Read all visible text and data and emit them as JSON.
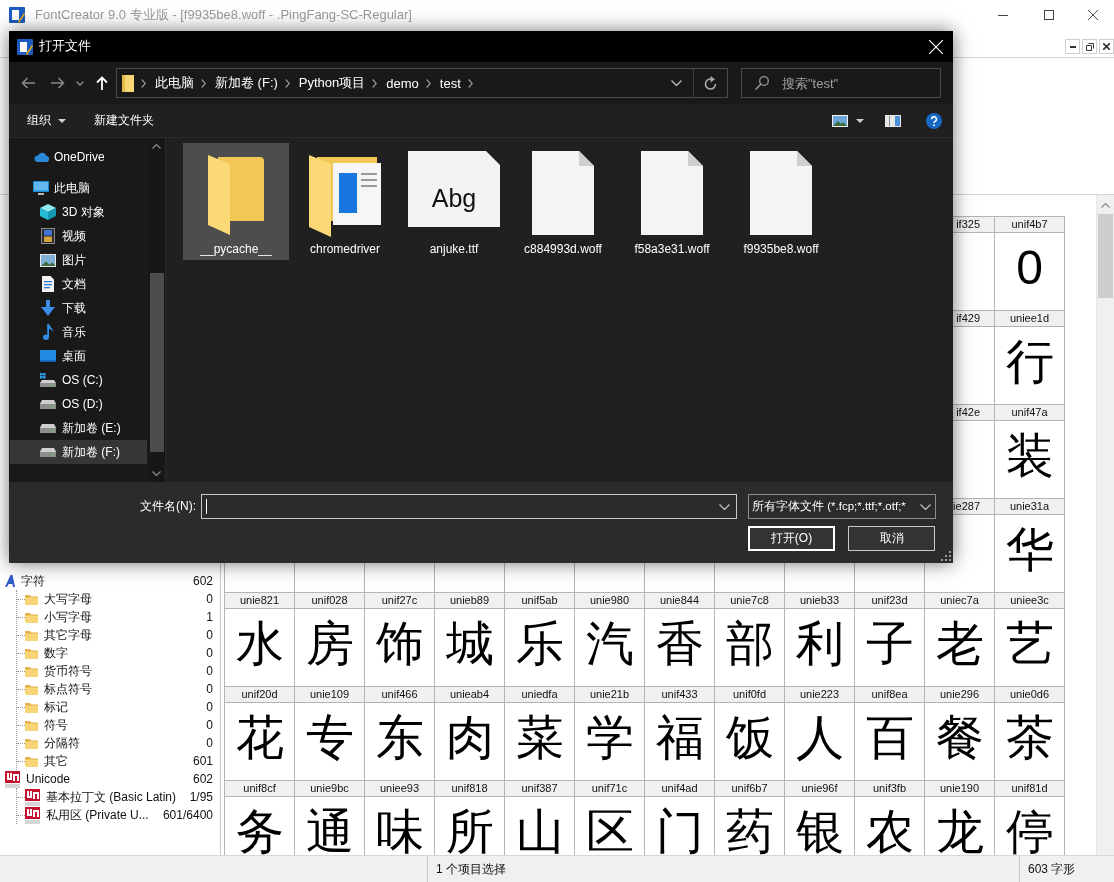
{
  "app_window": {
    "title": "FontCreator 9.0 专业版 - [f9935be8.woff - .PingFang-SC-Regular]"
  },
  "dialog": {
    "title": "打开文件",
    "address": {
      "path": [
        "此电脑",
        "新加卷 (F:)",
        "Python项目",
        "demo",
        "test"
      ]
    },
    "search": {
      "placeholder": "搜索\"test\""
    },
    "toolbar": {
      "organize": "组织",
      "new_folder": "新建文件夹"
    },
    "navigation": {
      "items": [
        {
          "label": "OneDrive",
          "kind": "cloud",
          "selected": false
        },
        {
          "label": "此电脑",
          "kind": "computer",
          "selected": false,
          "children": [
            {
              "label": "3D 对象",
              "kind": "objects3d",
              "selected": false
            },
            {
              "label": "视频",
              "kind": "videos",
              "selected": false
            },
            {
              "label": "图片",
              "kind": "pictures",
              "selected": false
            },
            {
              "label": "文档",
              "kind": "documents",
              "selected": false
            },
            {
              "label": "下载",
              "kind": "downloads",
              "selected": false
            },
            {
              "label": "音乐",
              "kind": "music",
              "selected": false
            },
            {
              "label": "桌面",
              "kind": "desktop",
              "selected": false
            },
            {
              "label": "OS (C:)",
              "kind": "system_drive",
              "selected": false
            },
            {
              "label": "OS (D:)",
              "kind": "drive",
              "selected": false
            },
            {
              "label": "新加卷 (E:)",
              "kind": "drive",
              "selected": false
            },
            {
              "label": "新加卷 (F:)",
              "kind": "drive",
              "selected": true
            }
          ]
        }
      ]
    },
    "files": [
      {
        "name": "__pycache__",
        "kind": "folder",
        "selected": true
      },
      {
        "name": "chromedriver",
        "kind": "app_folder",
        "selected": false
      },
      {
        "name": "anjuke.ttf",
        "kind": "font",
        "preview": "Abg",
        "selected": false
      },
      {
        "name": "c884993d.woff",
        "kind": "file",
        "selected": false
      },
      {
        "name": "f58a3e31.woff",
        "kind": "file",
        "selected": false
      },
      {
        "name": "f9935be8.woff",
        "kind": "file",
        "selected": false
      }
    ],
    "filename": {
      "label": "文件名(N):"
    },
    "file_type": {
      "value": "所有字体文件 (*.fcp;*.ttf;*.otf;*"
    },
    "buttons": [
      {
        "label": "打开(O)",
        "default": true
      },
      {
        "label": "取消",
        "default": false
      }
    ]
  },
  "sidebar": {
    "groups": [
      {
        "kind": "characters",
        "label": "字符",
        "count": "602",
        "children": [
          {
            "label": "大写字母",
            "count": "0"
          },
          {
            "label": "小写字母",
            "count": "1"
          },
          {
            "label": "其它字母",
            "count": "0"
          },
          {
            "label": "数字",
            "count": "0"
          },
          {
            "label": "货币符号",
            "count": "0"
          },
          {
            "label": "标点符号",
            "count": "0"
          },
          {
            "label": "标记",
            "count": "0"
          },
          {
            "label": "符号",
            "count": "0"
          },
          {
            "label": "分隔符",
            "count": "0"
          },
          {
            "label": "其它",
            "count": "601"
          }
        ]
      },
      {
        "kind": "unicode",
        "label": "Unicode",
        "count": "602",
        "children": [
          {
            "label": "基本拉丁文 (Basic Latin)",
            "count": "1/95"
          },
          {
            "label": "私用区 (Private U...",
            "count": "601/6400"
          }
        ]
      }
    ]
  },
  "glyph_grid": {
    "rows": [
      {
        "cells": [
          {
            "label": "if325"
          },
          {
            "label": "unif4b7",
            "glyph": "0"
          }
        ]
      },
      {
        "cells": [
          {
            "label": "if429"
          },
          {
            "label": "uniee1d",
            "glyph": "行"
          }
        ]
      },
      {
        "cells": [
          {
            "label": "if42e"
          },
          {
            "label": "unif47a",
            "glyph": "装"
          }
        ]
      },
      {
        "cells": [
          {
            "label": "ie287"
          },
          {
            "label": "unie31a",
            "glyph": "华"
          }
        ]
      },
      {
        "cells": [
          {
            "label": "unie821",
            "glyph": "水"
          },
          {
            "label": "unif028",
            "glyph": "房"
          },
          {
            "label": "unif27c",
            "glyph": "饰"
          },
          {
            "label": "unieb89",
            "glyph": "城"
          },
          {
            "label": "unif5ab",
            "glyph": "乐"
          },
          {
            "label": "unie980",
            "glyph": "汽"
          },
          {
            "label": "unie844",
            "glyph": "香"
          },
          {
            "label": "unie7c8",
            "glyph": "部"
          },
          {
            "label": "unieb33",
            "glyph": "利"
          },
          {
            "label": "unif23d",
            "glyph": "子"
          },
          {
            "label": "uniec7a",
            "glyph": "老"
          },
          {
            "label": "uniee3c",
            "glyph": "艺"
          }
        ]
      },
      {
        "cells": [
          {
            "label": "unif20d",
            "glyph": "花"
          },
          {
            "label": "unie109",
            "glyph": "专"
          },
          {
            "label": "unif466",
            "glyph": "东"
          },
          {
            "label": "unieab4",
            "glyph": "肉"
          },
          {
            "label": "uniedfa",
            "glyph": "菜"
          },
          {
            "label": "unie21b",
            "glyph": "学"
          },
          {
            "label": "unif433",
            "glyph": "福"
          },
          {
            "label": "unif0fd",
            "glyph": "饭"
          },
          {
            "label": "unie223",
            "glyph": "人"
          },
          {
            "label": "unif8ea",
            "glyph": "百"
          },
          {
            "label": "unie296",
            "glyph": "餐"
          },
          {
            "label": "unie0d6",
            "glyph": "茶"
          }
        ]
      },
      {
        "cells": [
          {
            "label": "unif8cf",
            "glyph": "务"
          },
          {
            "label": "unie9bc",
            "glyph": "通"
          },
          {
            "label": "uniee93",
            "glyph": "味"
          },
          {
            "label": "unif818",
            "glyph": "所"
          },
          {
            "label": "unif387",
            "glyph": "山"
          },
          {
            "label": "unif71c",
            "glyph": "区"
          },
          {
            "label": "unif4ad",
            "glyph": "门"
          },
          {
            "label": "unif6b7",
            "glyph": "药"
          },
          {
            "label": "unie96f",
            "glyph": "银"
          },
          {
            "label": "unif3fb",
            "glyph": "农"
          },
          {
            "label": "unie190",
            "glyph": "龙"
          },
          {
            "label": "unif81d",
            "glyph": "停"
          }
        ]
      }
    ]
  },
  "status_bar": {
    "selection": "1 个项目选择",
    "glyph_count": "603 字形"
  }
}
